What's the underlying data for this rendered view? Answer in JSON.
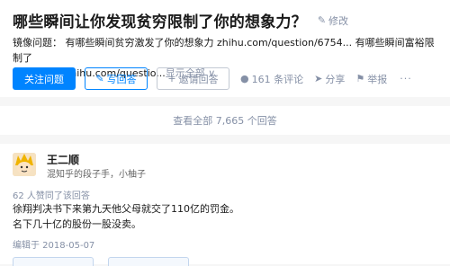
{
  "question": {
    "title": "哪些瞬间让你发现贫穷限制了你的想象力？",
    "edit_label": "修改",
    "redirect_line1": "镜像问题： 有哪些瞬间贫穷激发了你的想象力 zhihu.com/question/6754... 有哪些瞬间富裕限制了",
    "redirect_line2": "你的想象力 zhihu.com/questio...",
    "show_all_label": "显示全部 ∨"
  },
  "actions": {
    "follow_label": "关注问题",
    "write_label": "写回答",
    "invite_label": "邀请回答",
    "comments_label": "161 条评论",
    "share_label": "分享",
    "report_label": "举报",
    "more_label": "···"
  },
  "view_all": {
    "label": "查看全部 7,665 个回答"
  },
  "answer": {
    "author_name": "王二顺",
    "author_bio": "混知乎的段子手，小柚子",
    "upvotes": "62 人赞同了该回答",
    "body_line1": "徐翔判决书下来第九天他父母就交了110亿的罚金。",
    "body_line2": "名下几十亿的股份一股没卖。",
    "edited": "编辑于 2018-05-07"
  },
  "icons": {
    "edit": "pencil-icon",
    "write": "pencil-icon",
    "invite": "add-user-icon",
    "comments": "comment-bubble-icon",
    "share": "share-plane-icon",
    "report": "flag-icon",
    "show_all": "chevron-down-icon"
  },
  "colors": {
    "accent": "#0084ff",
    "meta": "#8590a6",
    "background": "#f6f6f6"
  }
}
